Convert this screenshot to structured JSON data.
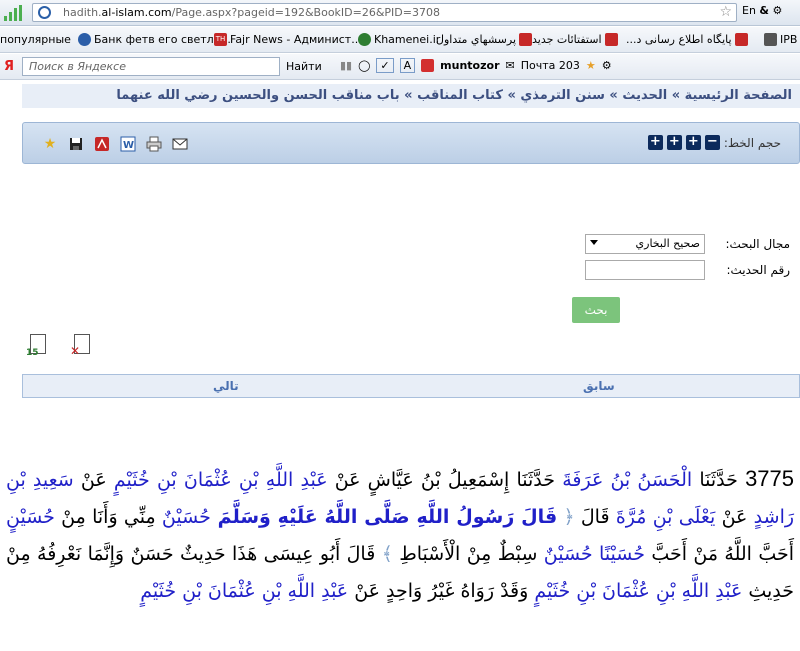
{
  "browser": {
    "url_prefix": "hadith.",
    "url_host": "al-islam.com",
    "url_path": "/Page.aspx?pageid=192&BookID=26&PID=3708",
    "lang_indicator": "En",
    "right_controls": "&"
  },
  "bookmarks": [
    {
      "label": "популярные",
      "color": "#4caf50"
    },
    {
      "label": "Банк фетв его светло...",
      "color": "#2b5ea8"
    },
    {
      "label": "Fajr News - Админист...",
      "color": "#c62828"
    },
    {
      "label": "Khamenei.ir",
      "color": "#2e7d32"
    },
    {
      "label": "پرسشهاي متداول",
      "color": "#c62828"
    },
    {
      "label": "استفتائات جديد",
      "color": "#c62828"
    },
    {
      "label": "پايگاه اطلاع رسانی د...",
      "color": "#c62828"
    },
    {
      "label": "IPB",
      "color": "#555"
    }
  ],
  "yandex": {
    "logo": "Я",
    "placeholder": "Поиск в Яндексе",
    "find": "Найти",
    "user": "muntozor",
    "mail": "Почта 203"
  },
  "breadcrumb": {
    "home": "الصفحة الرئيسية",
    "sep": " » ",
    "hadith": "الحديث",
    "book": "سنن الترمذي",
    "chapter": "كتاب المناقب",
    "section": "باب مناقب الحسن والحسين رضي الله عنهما"
  },
  "toolbar": {
    "font_size_label": "حجم الخط:",
    "minus": "−",
    "plus": "+",
    "icons": [
      "star-icon",
      "save-icon",
      "pdf-icon",
      "word-icon",
      "print-icon",
      "email-icon"
    ]
  },
  "search": {
    "scope_label": "مجال البحث:",
    "scope_value": "صحيح البخاري",
    "number_label": "رقم الحديث:",
    "button": "بحث"
  },
  "nav": {
    "prev": "سابق",
    "next": "تالي"
  },
  "hadith": {
    "number": "3775",
    "t1": " حَدَّثَنَا ",
    "n1": "الْحَسَنُ بْنُ عَرَفَةَ",
    "t2": " حَدَّثَنَا إِسْمَعِيلُ بْنُ عَيَّاشٍ عَنْ ",
    "n2": "عَبْدِ اللَّهِ بْنِ عُثْمَانَ بْنِ خُثَيْمٍ",
    "t3": " عَنْ ",
    "n3": "سَعِيدِ بْنِ رَاشِدٍ",
    "t4": " عَنْ ",
    "n4": "يَعْلَى بْنِ مُرَّةَ",
    "t5": " قَالَ ",
    "b1": "﴿",
    "q1": " قَالَ رَسُولُ اللَّهِ صَلَّى اللَّهُ عَلَيْهِ وَسَلَّمَ ",
    "n5": "حُسَيْنٌ",
    "t6": " مِنِّي وَأَنَا مِنْ ",
    "n6": "حُسَيْنٍ",
    "t7": " أَحَبَّ اللَّهُ مَنْ أَحَبَّ ",
    "n7": "حُسَيْنًا حُسَيْنٌ",
    "t8": " سِبْطٌ مِنْ الْأَسْبَاطِ ",
    "b2": "﴾",
    "t9": " قَالَ أَبُو عِيسَى هَذَا حَدِيثٌ حَسَنٌ وَإِنَّمَا نَعْرِفُهُ مِنْ حَدِيثِ ",
    "n8": "عَبْدِ اللَّهِ بْنِ عُثْمَانَ بْنِ خُثَيْمٍ",
    "t10": " وَقَدْ رَوَاهُ غَيْرُ وَاحِدٍ عَنْ ",
    "n9": "عَبْدِ اللَّهِ بْنِ عُثْمَانَ بْنِ خُثَيْمٍ"
  }
}
